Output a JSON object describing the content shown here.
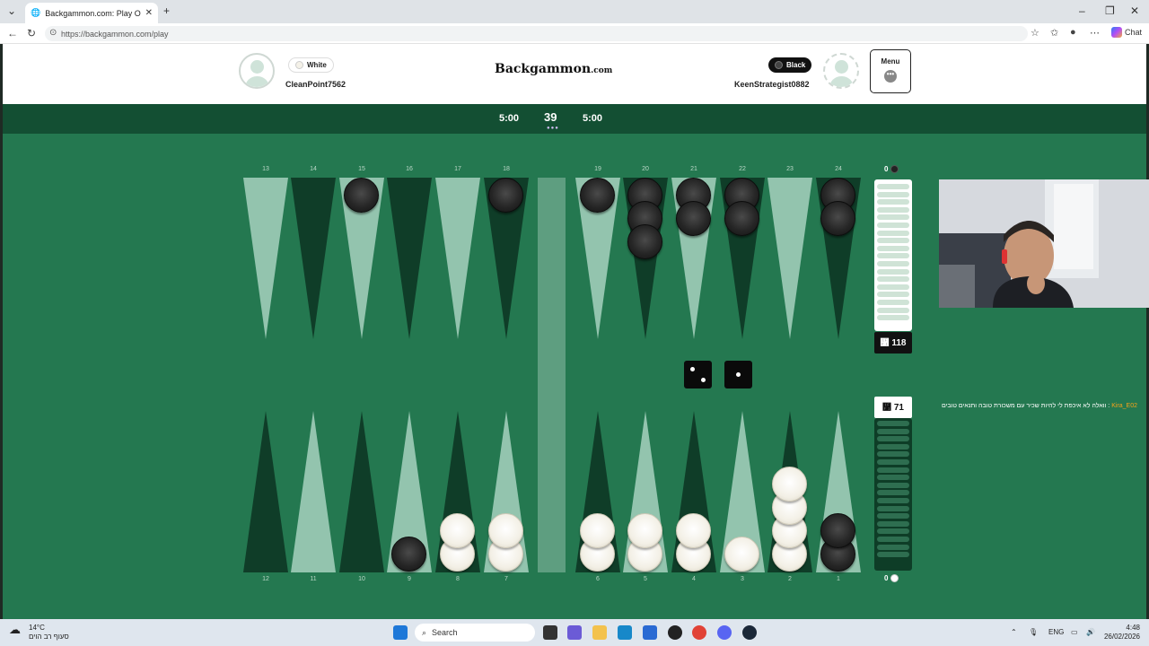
{
  "browser": {
    "tab_title": "Backgammon.com: Play Online Ba",
    "url": "https://backgammon.com/play",
    "chat_label": "Chat"
  },
  "header": {
    "logo_main": "Backgammon",
    "logo_suffix": ".com",
    "player_left": {
      "color_label": "White",
      "name": "CleanPoint7562"
    },
    "player_right": {
      "color_label": "Black",
      "name": "KeenStrategist0882"
    },
    "menu_label": "Menu"
  },
  "clock": {
    "left_time": "5:00",
    "right_time": "5:00",
    "center_value": "39"
  },
  "board": {
    "top_point_numbers": [
      "13",
      "14",
      "15",
      "16",
      "17",
      "18",
      "19",
      "20",
      "21",
      "22",
      "23",
      "24"
    ],
    "bottom_point_numbers": [
      "12",
      "11",
      "10",
      "9",
      "8",
      "7",
      "6",
      "5",
      "4",
      "3",
      "2",
      "1"
    ],
    "top_checkers": [
      0,
      0,
      1,
      0,
      0,
      1,
      1,
      3,
      2,
      2,
      0,
      2
    ],
    "bottom_checkers": [
      {
        "color": "none",
        "count": 0
      },
      {
        "color": "none",
        "count": 0
      },
      {
        "color": "none",
        "count": 0
      },
      {
        "color": "black",
        "count": 1
      },
      {
        "color": "white",
        "count": 2
      },
      {
        "color": "white",
        "count": 2
      },
      {
        "color": "white",
        "count": 2
      },
      {
        "color": "white",
        "count": 2
      },
      {
        "color": "white",
        "count": 2
      },
      {
        "color": "white",
        "count": 1
      },
      {
        "color": "white",
        "count": 4
      },
      {
        "color": "black",
        "count": 2
      }
    ],
    "black_off": "0",
    "white_off": "0",
    "black_pip": "118",
    "white_pip": "71",
    "pip_prefix": "῱",
    "dice": [
      2,
      1
    ]
  },
  "chat": {
    "user": "Kira_E02",
    "message": ": וואלה לא איכפת לי להיות שכיר עם משכורת טובה ותנאים טובים"
  },
  "taskbar": {
    "temperature": "14°C",
    "weather_desc": "סעוף רב הוים",
    "search_label": "Search",
    "lang": "ENG",
    "time": "4:48",
    "date": "26/02/2026"
  },
  "colors": {
    "felt": "#247850",
    "dark_point": "#0f3d28",
    "light_point": "#93c4ae",
    "header_band": "#134f33"
  }
}
